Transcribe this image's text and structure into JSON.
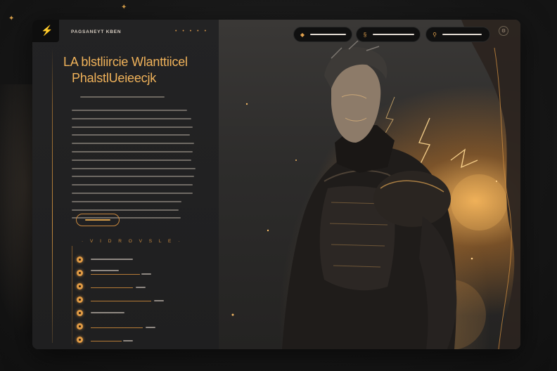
{
  "brand": {
    "name": "PAGSANEYT KBEN",
    "dots": "• • • • •"
  },
  "hero": {
    "title_line1": "LA blstliircie  Wlanttiicel",
    "title_line2": "PhalstlUeieecjk"
  },
  "nav": {
    "pills": [
      {
        "icon": "◆"
      },
      {
        "icon": "§"
      },
      {
        "icon": "⚲"
      }
    ],
    "settings_icon": "⚙"
  },
  "section": {
    "title": "· V I D R O V S L E ·"
  },
  "items_count": 6,
  "colors": {
    "accent": "#e09a44",
    "panel": "#1f1f20",
    "text": "#f0b25a"
  },
  "icons": {
    "logo": "bolt-icon",
    "pill1": "diamond-icon",
    "pill2": "section-icon",
    "pill3": "user-icon",
    "corner": "settings-icon"
  }
}
